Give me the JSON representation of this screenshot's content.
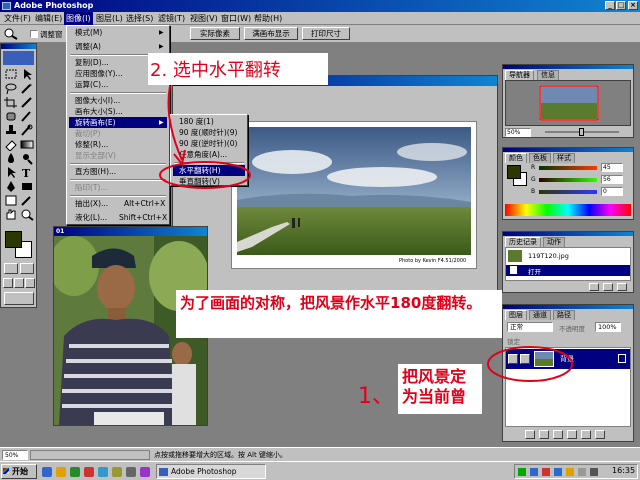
{
  "app": {
    "title": "Adobe Photoshop"
  },
  "menubar": {
    "items": [
      "文件(F)",
      "编辑(E)",
      "图像(I)",
      "图层(L)",
      "选择(S)",
      "滤镜(T)",
      "视图(V)",
      "窗口(W)",
      "帮助(H)"
    ]
  },
  "options_bar": {
    "checkbox_label": "调整窗",
    "buttons": [
      "实际像素",
      "满画布显示",
      "打印尺寸"
    ]
  },
  "image_menu": {
    "items": [
      {
        "label": "模式(M)",
        "sub": true
      },
      {
        "label": "调整(A)",
        "sub": true
      },
      {
        "label": "复制(D)..."
      },
      {
        "label": "应用图像(Y)..."
      },
      {
        "label": "运算(C)..."
      },
      {
        "label": "图像大小(I)..."
      },
      {
        "label": "画布大小(S)..."
      },
      {
        "label": "旋转画布(E)",
        "sub": true,
        "highlight": true
      },
      {
        "label": "裁切(P)",
        "disabled": true
      },
      {
        "label": "修整(R)..."
      },
      {
        "label": "显示全部(V)",
        "disabled": true
      },
      {
        "label": "直方图(H)..."
      },
      {
        "label": "陷印(T)...",
        "disabled": true
      },
      {
        "label": "抽出(X)...",
        "shortcut": "Alt+Ctrl+X"
      },
      {
        "label": "液化(L)...",
        "shortcut": "Shift+Ctrl+X"
      }
    ]
  },
  "rotate_submenu": {
    "items": [
      "180 度(1)",
      "90 度(顺时针)(9)",
      "90 度(逆时针)(0)",
      "任意角度(A)...",
      "水平翻转(H)",
      "垂直翻转(V)"
    ]
  },
  "doc": {
    "photo_credit": "Photo by Kevin F4.51/2000"
  },
  "portrait_doc": {
    "title": "01"
  },
  "annotations": {
    "step2": "2. 选中水平翻转",
    "explain": "为了画面的对称，把风景作水平180度翻转。",
    "step1_num": "1、",
    "step1": "把风景定为当前曾"
  },
  "navigator": {
    "tabs": [
      "导航器",
      "信息"
    ],
    "zoom": "50%"
  },
  "color_panel": {
    "tabs": [
      "颜色",
      "色板",
      "样式"
    ],
    "channels": [
      {
        "label": "R",
        "value": "45"
      },
      {
        "label": "G",
        "value": "56"
      },
      {
        "label": "B",
        "value": "0"
      }
    ],
    "fg_color": "#2d3800"
  },
  "history_panel": {
    "tabs": [
      "历史记录",
      "动作"
    ],
    "snapshot": "119T120.jpg",
    "step": "打开"
  },
  "layers_panel": {
    "tabs": [
      "图层",
      "通道",
      "路径"
    ],
    "blend_mode": "正常",
    "opacity_label": "不透明度",
    "opacity": "100%",
    "lock_label": "锁定",
    "layer_name": "背景"
  },
  "statusbar": {
    "zoom": "50%",
    "hint": "点按或拖移要增大的区域。按 Alt 键缩小。"
  },
  "taskbar": {
    "start": "开始",
    "task": "Adobe Photoshop",
    "clock": "16:35"
  },
  "colors": {
    "accent": "#000080",
    "annotation_red": "#e0001a",
    "chrome": "#c0c0c0"
  }
}
